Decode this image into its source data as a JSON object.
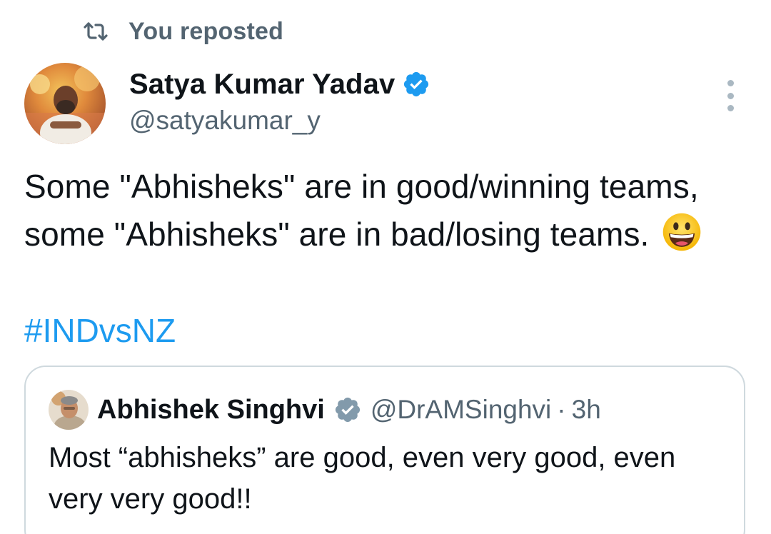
{
  "repost": {
    "label": "You reposted",
    "icon": "repost-icon"
  },
  "author": {
    "display_name": "Satya Kumar Yadav",
    "handle": "@satyakumar_y",
    "verified": true,
    "verified_color": "#1d9bf0"
  },
  "tweet": {
    "text": "Some \"Abhisheks\" are in good/winning teams, some \"Abhisheks\" are in bad/losing teams.",
    "emoji": "grinning-face",
    "hashtag": "#INDvsNZ",
    "hashtag_color": "#1d9bf0"
  },
  "quote": {
    "display_name": "Abhishek Singhvi",
    "handle": "@DrAMSinghvi",
    "separator": "·",
    "time": "3h",
    "verified_color": "#829aab",
    "text": "Most “abhisheks” are good, even very good, even very very good!!"
  },
  "menu": {
    "icon": "more-vertical-icon"
  }
}
